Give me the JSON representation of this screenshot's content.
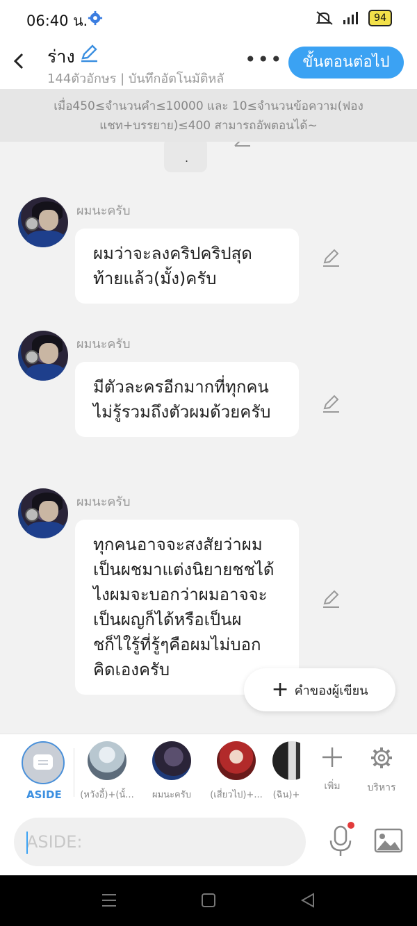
{
  "status_bar": {
    "time": "06:40 น.",
    "battery": "94"
  },
  "header": {
    "title": "ร่าง",
    "subtitle": "144ตัวอักษร | บันทึกอัตโนมัติหลั",
    "next_label": "ขั้นตอนต่อไป"
  },
  "notice": {
    "line1": "เมื่อ450≤จำนวนคำ≤10000 และ 10≤จำนวนข้อความ(ฟอง",
    "line2": "แชท+บรรยาย)≤400 สามารถอัพตอนได้~"
  },
  "chat": {
    "partial_text": ".",
    "messages": [
      {
        "speaker": "ผมนะครับ",
        "text": "ผมว่าจะลงคริปคริปสุดท้ายแล้ว(มั้ง)ครับ"
      },
      {
        "speaker": "ผมนะครับ",
        "text": "มีตัวละครอีกมากที่ทุกคนไม่รู้รวมถึงตัวผมด้วยครับ"
      },
      {
        "speaker": "ผมนะครับ",
        "text": "ทุกคนอาจจะสงสัยว่าผมเป็นผชมาแต่งนิยายชชได้ไงผมจะบอกว่าผมอาจจะเป็นผญก็ได้หรือเป็นผชก็ไใรู้ที่รู้ๆคือผมไม่บอกคิดเองครับ"
      }
    ]
  },
  "fab": {
    "label": "คำของผู้เขียน"
  },
  "roles": {
    "aside_label": "ASIDE",
    "items": [
      {
        "label": "(หวังอี้)+(นั้..."
      },
      {
        "label": "ผมนะครับ"
      },
      {
        "label": "(เสี่ยวไป)+..."
      },
      {
        "label": "(ฉิน)+"
      }
    ],
    "add_label": "เพิ่ม",
    "manage_label": "บริหาร"
  },
  "input": {
    "placeholder": "ASIDE:"
  },
  "colors": {
    "accent": "#3ba2f3",
    "background": "#f2f2f2"
  }
}
